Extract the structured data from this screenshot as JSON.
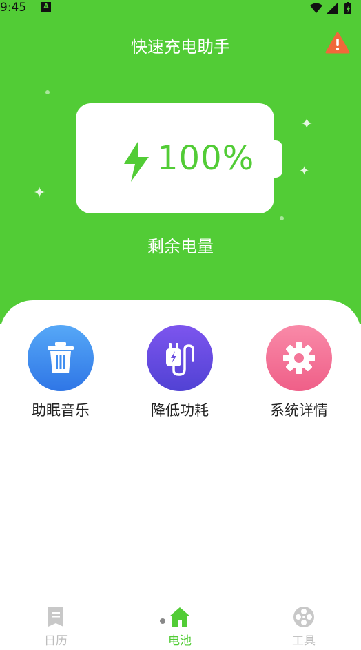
{
  "status_bar": {
    "time": "9:45",
    "notification_badge": "A"
  },
  "header": {
    "title": "快速充电助手"
  },
  "battery": {
    "percent_text": "100%",
    "level_percent": 100,
    "caption": "剩余电量"
  },
  "tools": [
    {
      "label": "助眠音乐",
      "icon": "trash-icon",
      "color": "#3f8ef0"
    },
    {
      "label": "降低功耗",
      "icon": "plug-icon",
      "color": "#6a4de0"
    },
    {
      "label": "系统详情",
      "icon": "gear-icon",
      "color": "#f47699"
    }
  ],
  "bottom_nav": {
    "items": [
      {
        "label": "日历",
        "icon": "calendar-icon",
        "active": false
      },
      {
        "label": "电池",
        "icon": "home-icon",
        "active": true
      },
      {
        "label": "工具",
        "icon": "film-reel-icon",
        "active": false
      }
    ]
  },
  "colors": {
    "primary_green": "#52cc36",
    "inactive_nav": "#bdbdbd",
    "warning": "#f0683a"
  }
}
